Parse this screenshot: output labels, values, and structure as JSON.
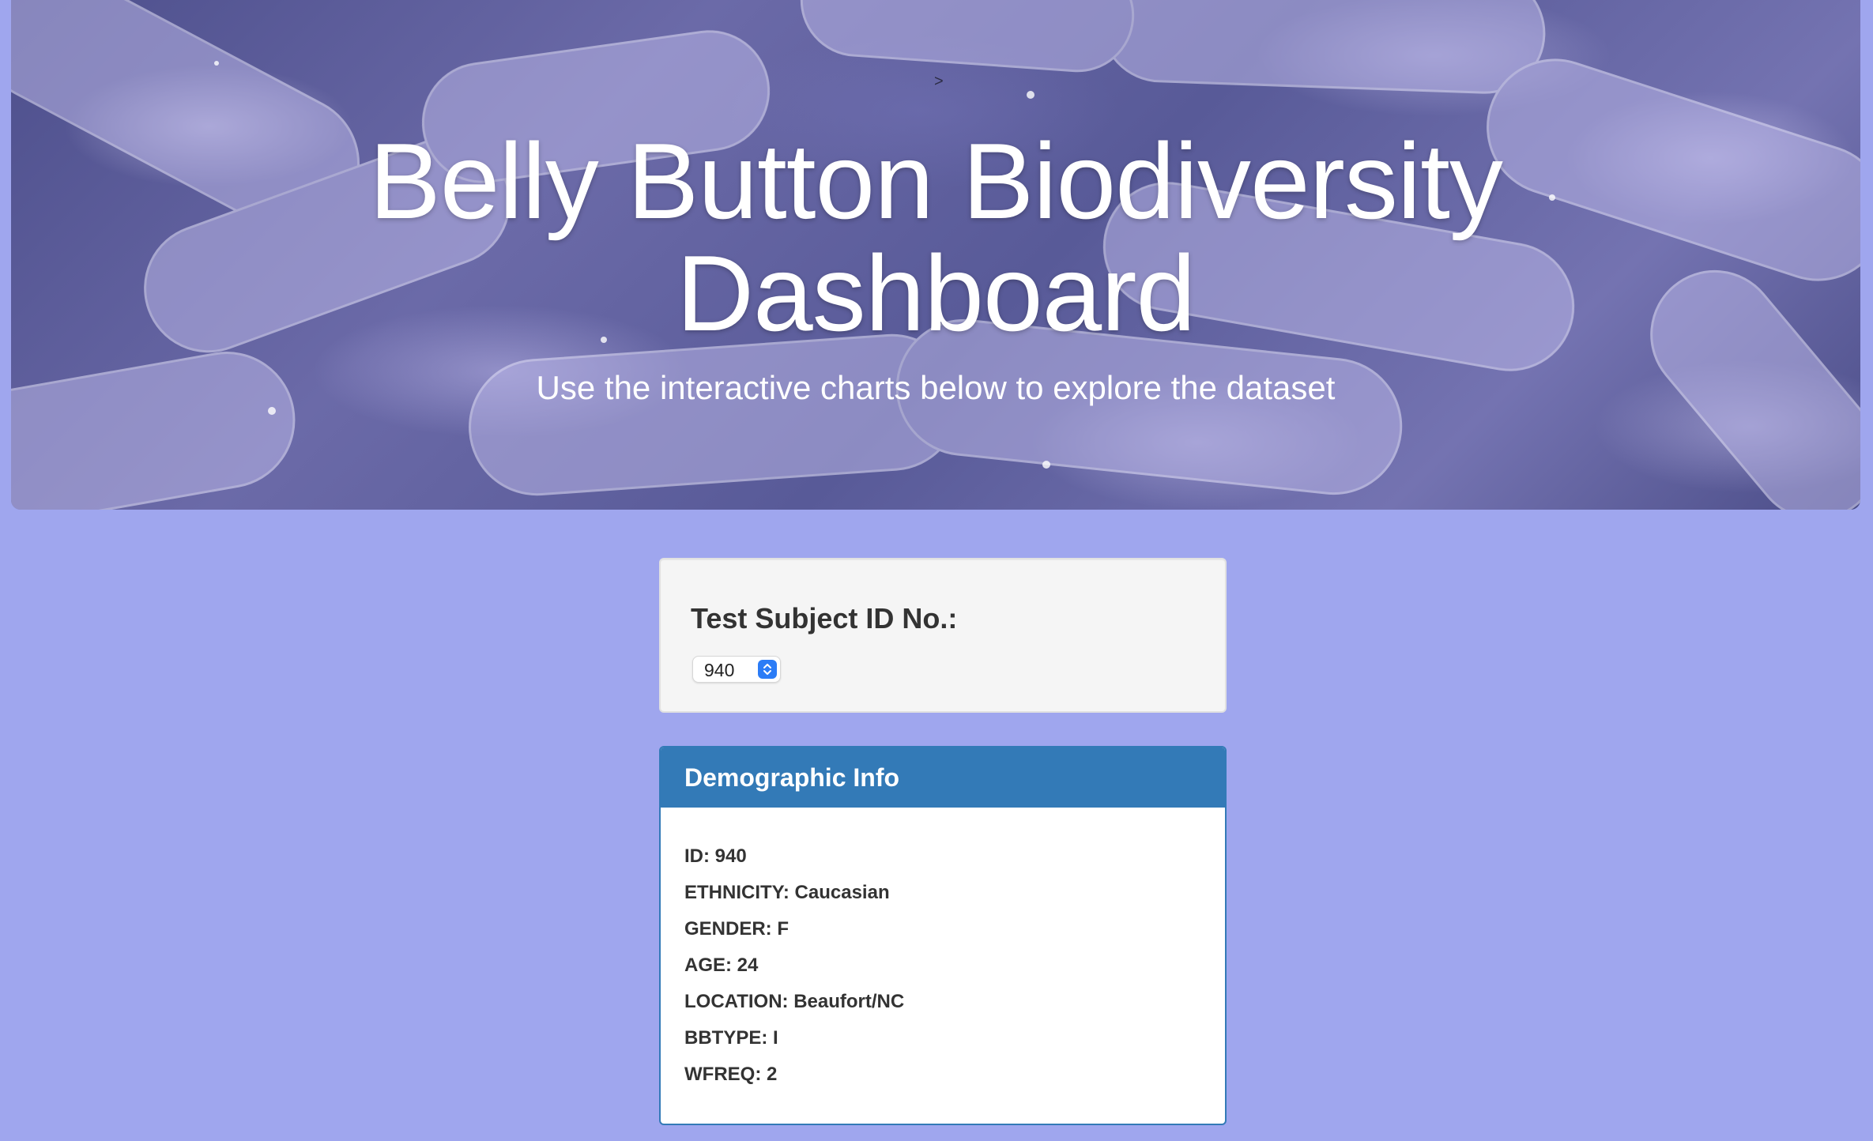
{
  "header": {
    "title_line1": "Belly Button Biodiversity",
    "title_line2": "Dashboard",
    "subtitle": "Use the interactive charts below to explore the dataset",
    "stray_mark": ">"
  },
  "selector": {
    "heading": "Test Subject ID No.:",
    "selected_value": "940"
  },
  "demographics": {
    "title": "Demographic Info",
    "items": [
      "ID: 940",
      "ETHNICITY: Caucasian",
      "GENDER: F",
      "AGE: 24",
      "LOCATION: Beaufort/NC",
      "BBTYPE: I",
      "WFREQ: 2"
    ]
  },
  "colors": {
    "page_background": "#9fa6ee",
    "panel_primary": "#337ab7",
    "well_background": "#f5f5f5",
    "select_accent": "#2b7cf6"
  },
  "icons": {
    "select_arrows": "updown-chevron-icon"
  }
}
